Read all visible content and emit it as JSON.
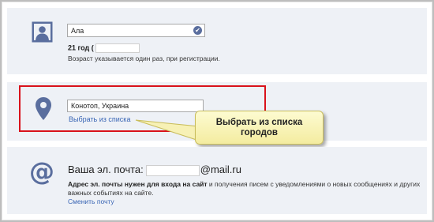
{
  "profile": {
    "name_value": "Ала",
    "age_value": "21 год (",
    "age_hint": "Возраст указывается один раз, при регистрации."
  },
  "location": {
    "city_value": "Конотоп, Украина",
    "choose_link": "Выбрать из списка"
  },
  "callout": {
    "text": "Выбрать из списка городов"
  },
  "email": {
    "label": "Ваша эл. почта:",
    "domain": "@mail.ru",
    "hint_bold": "Адрес эл. почты нужен для входа на сайт",
    "hint_rest": " и получения писем с уведомлениями о новых сообщениях и других важных событиях на сайте.",
    "change_link": "Сменить почту"
  },
  "colors": {
    "accent_icon": "#5a6e9e",
    "link": "#3a66b5",
    "highlight": "#d9121b",
    "callout_bg": "#f7f1b5"
  },
  "icons": [
    "user-avatar-icon",
    "checkmark-icon",
    "location-pin-icon",
    "at-sign-icon"
  ]
}
